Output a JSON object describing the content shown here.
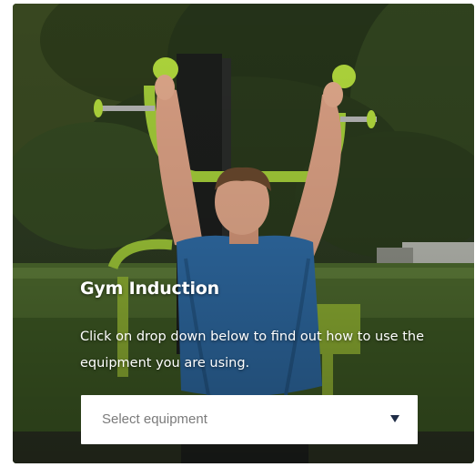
{
  "induction": {
    "title": "Gym Induction",
    "description": "Click on drop down below to find out how to use the equipment you are using.",
    "select": {
      "placeholder": "Select equipment",
      "arrow_icon": "caret-down-icon"
    }
  },
  "colors": {
    "equipment_green": "#a6d13a",
    "shirt_blue": "#2f6ca6",
    "text": "#ffffff",
    "placeholder": "#7b7b7b"
  }
}
